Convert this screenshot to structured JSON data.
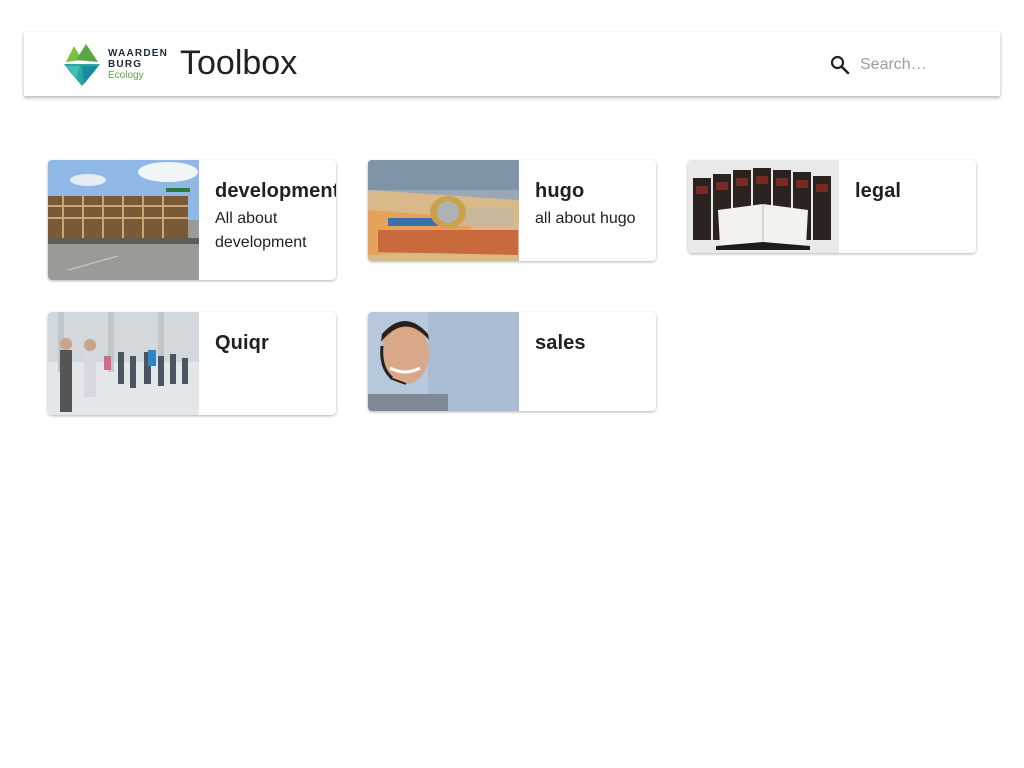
{
  "header": {
    "logo": {
      "line1": "WAARDEN",
      "line2": "BURG",
      "line3": "Ecology"
    },
    "title": "Toolbox",
    "search_placeholder": "Search…"
  },
  "cards": [
    {
      "name": "development",
      "description": "All about development",
      "image": "construction-site-photo"
    },
    {
      "name": "hugo",
      "description": "all about hugo",
      "image": "money-coins-photo"
    },
    {
      "name": "legal",
      "description": "",
      "image": "law-books-photo"
    },
    {
      "name": "Quiqr",
      "description": "",
      "image": "business-people-photo"
    },
    {
      "name": "sales",
      "description": "",
      "image": "call-center-agent-photo"
    }
  ],
  "colors": {
    "brand_green": "#5aa646",
    "brand_teal": "#2aa7a0",
    "text": "#212121"
  }
}
